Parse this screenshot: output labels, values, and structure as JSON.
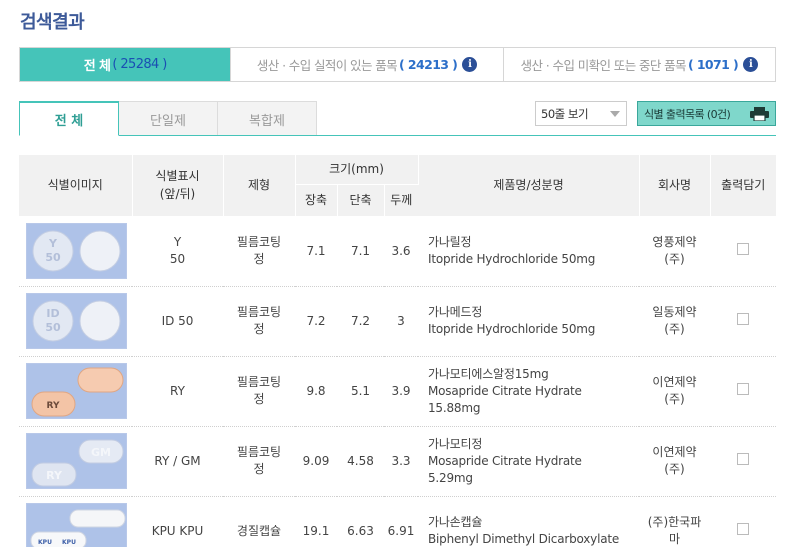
{
  "page_title": "검색결과",
  "result_tabs": [
    {
      "label": "전 체",
      "count": "( 25284 )"
    },
    {
      "label": "생산 · 수입 실적이 있는 품목",
      "count": "( 24213 )"
    },
    {
      "label": "생산 · 수입 미확인 또는 중단 품목",
      "count": "( 1071 )"
    }
  ],
  "info_glyph": "i",
  "sub_tabs": [
    "전 체",
    "단일제",
    "복합제"
  ],
  "view_select": {
    "value": "50줄 보기"
  },
  "print_button": {
    "label": "식별 출력목록 (0건)"
  },
  "headers": {
    "image": "식별이미지",
    "mark_line1": "식별표시",
    "mark_line2": "(앞/뒤)",
    "form": "제형",
    "size": "크기(mm)",
    "long": "장축",
    "short": "단축",
    "thick": "두께",
    "product": "제품명/성분명",
    "company": "회사명",
    "cart": "출력담기"
  },
  "rows": [
    {
      "mark": [
        "Y",
        "50"
      ],
      "form": [
        "필름코팅",
        "정"
      ],
      "long": "7.1",
      "short": "7.1",
      "thick": "3.6",
      "product": [
        "가나릴정",
        "Itopride Hydrochloride    50mg"
      ],
      "company": [
        "영풍제약",
        "(주)"
      ],
      "img": "round-white",
      "imprint": [
        "Y",
        "50"
      ]
    },
    {
      "mark": [
        "ID 50"
      ],
      "form": [
        "필름코팅",
        "정"
      ],
      "long": "7.2",
      "short": "7.2",
      "thick": "3",
      "product": [
        "가나메드정",
        "Itopride Hydrochloride    50mg"
      ],
      "company": [
        "일동제약",
        "(주)"
      ],
      "img": "round-white",
      "imprint": [
        "ID",
        "50"
      ]
    },
    {
      "mark": [
        "RY"
      ],
      "form": [
        "필름코팅",
        "정"
      ],
      "long": "9.8",
      "short": "5.1",
      "thick": "3.9",
      "product": [
        "가나모티에스알정15mg",
        "Mosapride Citrate Hydrate",
        "15.88mg"
      ],
      "company": [
        "이연제약",
        "(주)"
      ],
      "img": "oval-peach",
      "imprint": [
        "RY",
        ""
      ]
    },
    {
      "mark": [
        "RY / GM"
      ],
      "form": [
        "필름코팅",
        "정"
      ],
      "long": "9.09",
      "short": "4.58",
      "thick": "3.3",
      "product": [
        "가나모티정",
        "Mosapride Citrate Hydrate",
        "5.29mg"
      ],
      "company": [
        "이연제약",
        "(주)"
      ],
      "img": "oval-white",
      "imprint": [
        "RY",
        "GM"
      ]
    },
    {
      "mark": [
        "KPU KPU"
      ],
      "form": [
        "경질캡슐"
      ],
      "long": "19.1",
      "short": "6.63",
      "thick": "6.91",
      "product": [
        "가나손캡슐",
        "Biphenyl Dimethyl Dicarboxylate"
      ],
      "company": [
        "(주)한국파",
        "마"
      ],
      "img": "capsule",
      "imprint": [
        "KPU",
        "KPU"
      ]
    }
  ]
}
